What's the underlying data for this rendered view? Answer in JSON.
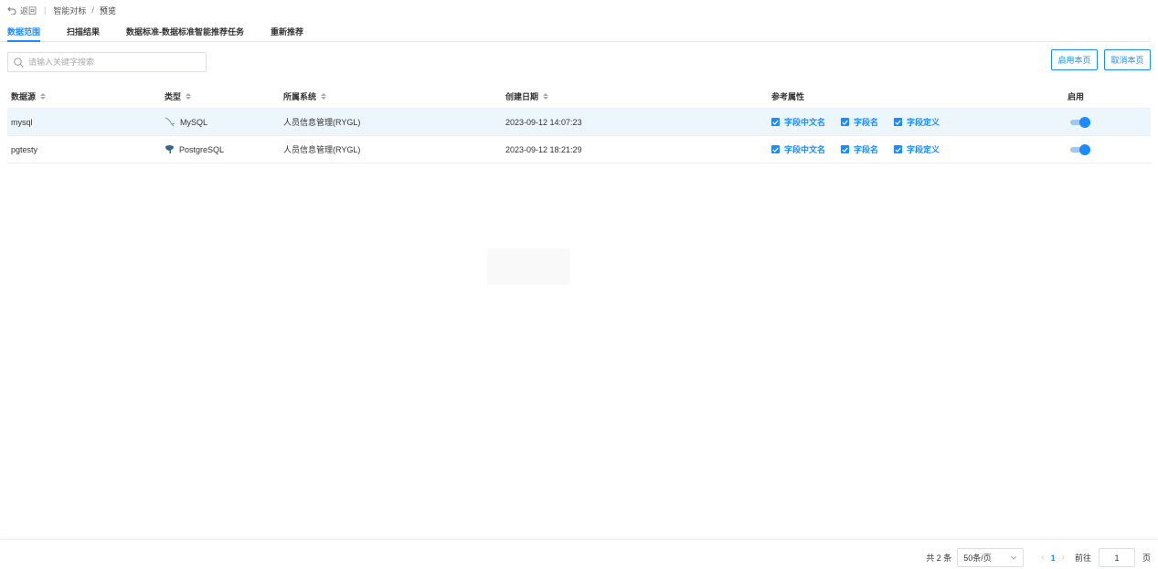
{
  "topbar": {
    "back": "返回",
    "crumb_parent": "智能对标",
    "crumb_current": "预览"
  },
  "tabs": [
    {
      "label": "数据范围",
      "active": true
    },
    {
      "label": "扫描结果",
      "active": false
    },
    {
      "label": "数据标准-数据标准智能推荐任务",
      "active": false
    },
    {
      "label": "重新推荐",
      "active": false
    }
  ],
  "search": {
    "placeholder": "请输入关键字搜索",
    "value": ""
  },
  "actions": {
    "enable_page": "启用本页",
    "cancel_page": "取消本页"
  },
  "table": {
    "headers": [
      "数据源",
      "类型",
      "所属系统",
      "创建日期",
      "参考属性",
      "启用"
    ],
    "rows": [
      {
        "source": "mysql",
        "type": "MySQL",
        "type_icon": "mysql-dolphin-icon",
        "system": "人员信息管理(RYGL)",
        "created": "2023-09-12 14:07:23",
        "attrs": [
          "字段中文名",
          "字段名",
          "字段定义"
        ],
        "enabled": true
      },
      {
        "source": "pgtesty",
        "type": "PostgreSQL",
        "type_icon": "postgresql-elephant-icon",
        "system": "人员信息管理(RYGL)",
        "created": "2023-09-12 18:21:29",
        "attrs": [
          "字段中文名",
          "字段名",
          "字段定义"
        ],
        "enabled": true
      }
    ]
  },
  "pagination": {
    "total": "共 2 条",
    "page_size": "50条/页",
    "current_page": "1",
    "goto_label": "前往",
    "goto_value": "1",
    "page_unit": "页"
  },
  "colors": {
    "accent": "#1a8cff",
    "row_highlight": "#eef6fd"
  }
}
